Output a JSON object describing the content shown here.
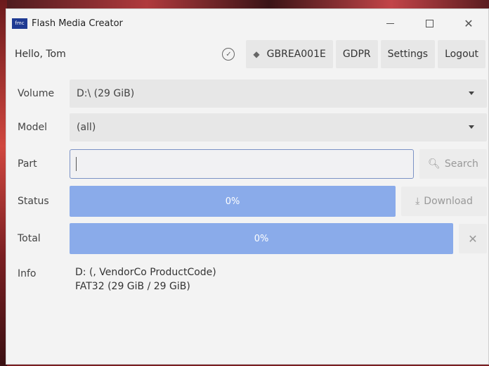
{
  "window": {
    "icon_text": "fmc",
    "title": "Flash Media Creator",
    "controls": {
      "minimize": "minimize",
      "maximize": "maximize",
      "close": "✕"
    }
  },
  "header": {
    "greeting": "Hello, Tom",
    "buttons": {
      "region": "GBREA001E",
      "gdpr": "GDPR",
      "settings": "Settings",
      "logout": "Logout"
    }
  },
  "form": {
    "volume": {
      "label": "Volume",
      "value": "D:\\ (29 GiB)"
    },
    "model": {
      "label": "Model",
      "value": "(all)"
    },
    "part": {
      "label": "Part",
      "value": "",
      "search_label": "Search"
    },
    "status": {
      "label": "Status",
      "progress_text": "0%",
      "progress_value": 0,
      "download_label": "Download"
    },
    "total": {
      "label": "Total",
      "progress_text": "0%",
      "progress_value": 0,
      "cancel_label": "✕"
    },
    "info": {
      "label": "Info",
      "line1": "D: (, VendorCo ProductCode)",
      "line2": "FAT32 (29 GiB / 29 GiB)"
    }
  },
  "colors": {
    "progress_fill": "#8aabea",
    "input_border": "#7b92c5",
    "button_bg": "#e7e7e7",
    "window_bg": "#f3f3f3",
    "app_icon_bg": "#1f3a93"
  },
  "icons": {
    "verified": "check-circle-icon",
    "region": "layers-icon",
    "search": "search-icon",
    "download": "download-icon"
  }
}
